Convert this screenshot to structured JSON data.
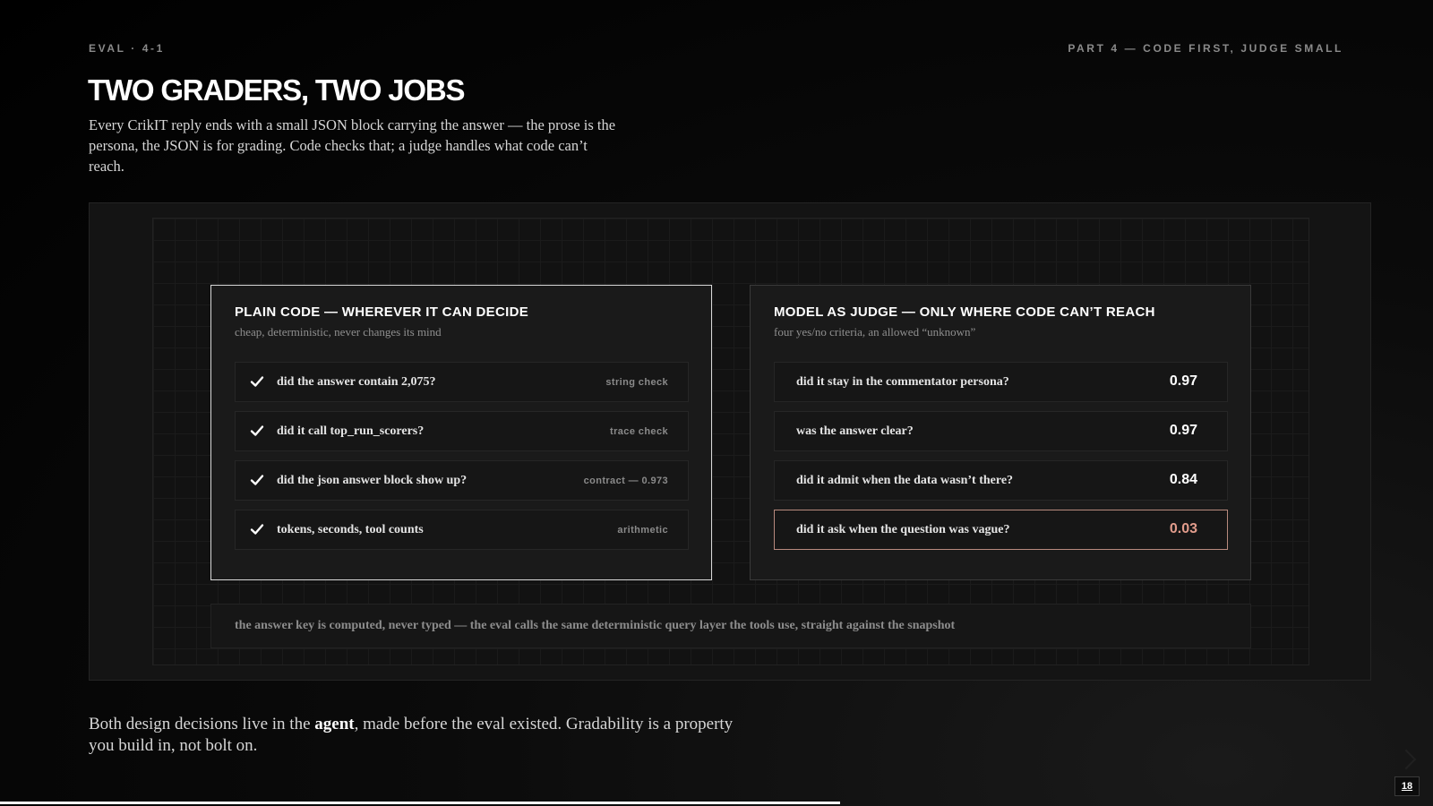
{
  "header": {
    "section_tag": "EVAL · 4-1",
    "part_label": "PART 4 — CODE FIRST, JUDGE SMALL"
  },
  "title": "TWO GRADERS, TWO JOBS",
  "lede": "Every CrikIT reply ends with a small JSON block carrying the answer — the prose is the persona, the JSON is for grading. Code checks that; a judge handles what code can’t reach.",
  "code_panel": {
    "title": "PLAIN CODE — WHEREVER IT CAN DECIDE",
    "subtitle": "cheap, deterministic, never changes its mind",
    "rows": [
      {
        "text": "did the answer contain 2,075?",
        "tag": "string check",
        "icon": "check-icon"
      },
      {
        "text": "did it call top_run_scorers?",
        "tag": "trace check",
        "icon": "check-icon"
      },
      {
        "text": "did the json answer block show up?",
        "tag": "contract — 0.973",
        "icon": "check-icon"
      },
      {
        "text": "tokens, seconds, tool counts",
        "tag": "arithmetic",
        "icon": "check-icon"
      }
    ]
  },
  "judge_panel": {
    "title": "MODEL AS JUDGE — ONLY WHERE CODE CAN’T REACH",
    "subtitle": "four yes/no criteria, an allowed “unknown”",
    "rows": [
      {
        "text": "did it stay in the commentator persona?",
        "score": "0.97"
      },
      {
        "text": "was the answer clear?",
        "score": "0.97"
      },
      {
        "text": "did it admit when the data wasn’t there?",
        "score": "0.84"
      },
      {
        "text": "did it ask when the question was vague?",
        "score": "0.03",
        "flagged": true
      }
    ],
    "flag_color": "#e29c8c"
  },
  "footnote": "the answer key is computed, never typed — the eval calls the same deterministic query layer the tools use, straight against the snapshot",
  "closing": {
    "before": "Both design decisions live in the ",
    "emphasis": "agent",
    "after": ", made before the eval existed. Gradability is a property you build in, not bolt on."
  },
  "page_number": "18",
  "deck_progress": 0.586
}
